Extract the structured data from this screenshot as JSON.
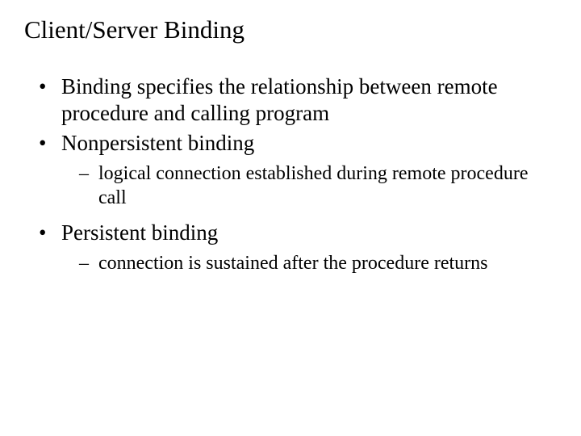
{
  "title": "Client/Server Binding",
  "bullets": [
    {
      "text": "Binding specifies the relationship between remote procedure and calling program",
      "children": []
    },
    {
      "text": "Nonpersistent binding",
      "children": [
        {
          "text": "logical connection established during remote procedure call"
        }
      ]
    },
    {
      "text": "Persistent binding",
      "children": [
        {
          "text": "connection is sustained after the procedure returns"
        }
      ]
    }
  ]
}
